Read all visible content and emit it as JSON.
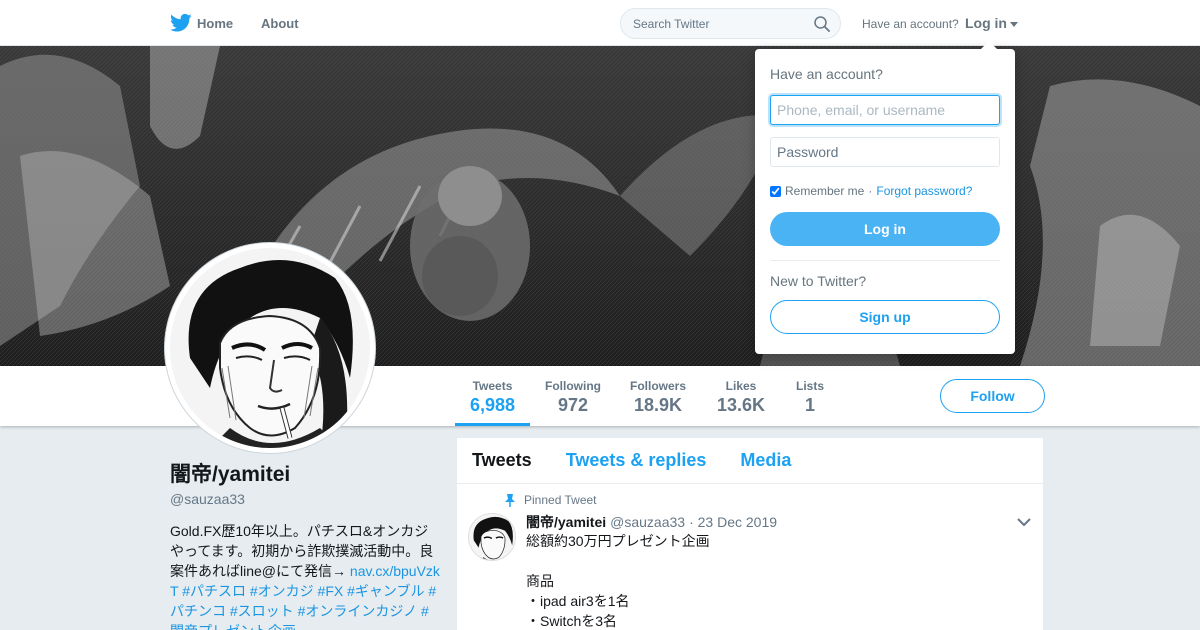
{
  "nav": {
    "home_label": "Home",
    "about_label": "About",
    "search_placeholder": "Search Twitter",
    "have_account": "Have an account?",
    "login_label": "Log in",
    "brand_color": "#1da1f2"
  },
  "profile": {
    "name": "闇帝/yamitei",
    "handle": "@sauzaa33",
    "bio_text": "Gold.FX歴10年以上。パチスロ&オンカジやってます。初期から詐欺撲滅活動中。良案件あればline@にて発信→",
    "bio_link": "nav.cx/bpuVzkT",
    "bio_tags": "#パチスロ #オンカジ #FX #ギャンブル #パチンコ #スロット #オンラインカジノ #闇帝プレゼント企画"
  },
  "stats": [
    {
      "label": "Tweets",
      "value": "6,988"
    },
    {
      "label": "Following",
      "value": "972"
    },
    {
      "label": "Followers",
      "value": "18.9K"
    },
    {
      "label": "Likes",
      "value": "13.6K"
    },
    {
      "label": "Lists",
      "value": "1"
    }
  ],
  "follow_label": "Follow",
  "timeline": {
    "tabs": [
      "Tweets",
      "Tweets & replies",
      "Media"
    ],
    "tweet": {
      "pinned_label": "Pinned Tweet",
      "name": "闇帝/yamitei",
      "handle": "@sauzaa33",
      "date": "· 23 Dec 2019",
      "lines": [
        "総額約30万円プレゼント企画",
        "",
        "商品",
        "・ipad air3を1名",
        "・Switchを3名"
      ]
    }
  },
  "login_dropdown": {
    "title": "Have an account?",
    "username_placeholder": "Phone, email, or username",
    "password_placeholder": "Password",
    "remember_label": "Remember me",
    "separator": "·",
    "forgot_label": "Forgot password?",
    "login_button": "Log in",
    "new_label": "New to Twitter?",
    "signup_button": "Sign up"
  }
}
